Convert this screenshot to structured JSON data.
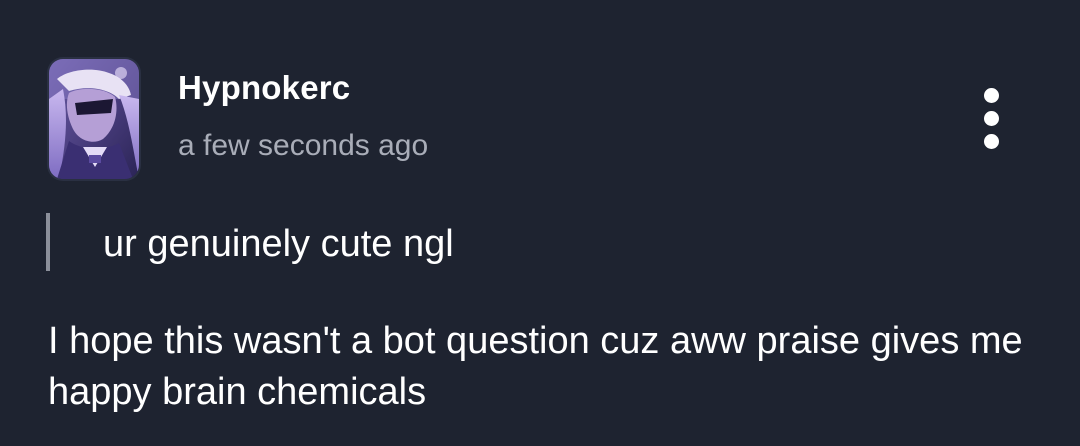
{
  "post": {
    "username": "Hypnokerc",
    "timestamp": "a few seconds ago",
    "quoted_text": "ur genuinely cute ngl",
    "reply_text": "I hope this wasn't a bot question cuz aww praise gives me happy brain chemicals"
  },
  "icons": {
    "avatar": "user-avatar",
    "menu": "kebab-menu-icon"
  },
  "colors": {
    "background": "#1e2330",
    "text": "#ffffff",
    "secondary_text": "#a9adb8",
    "quote_bar": "#8b8f9a"
  }
}
